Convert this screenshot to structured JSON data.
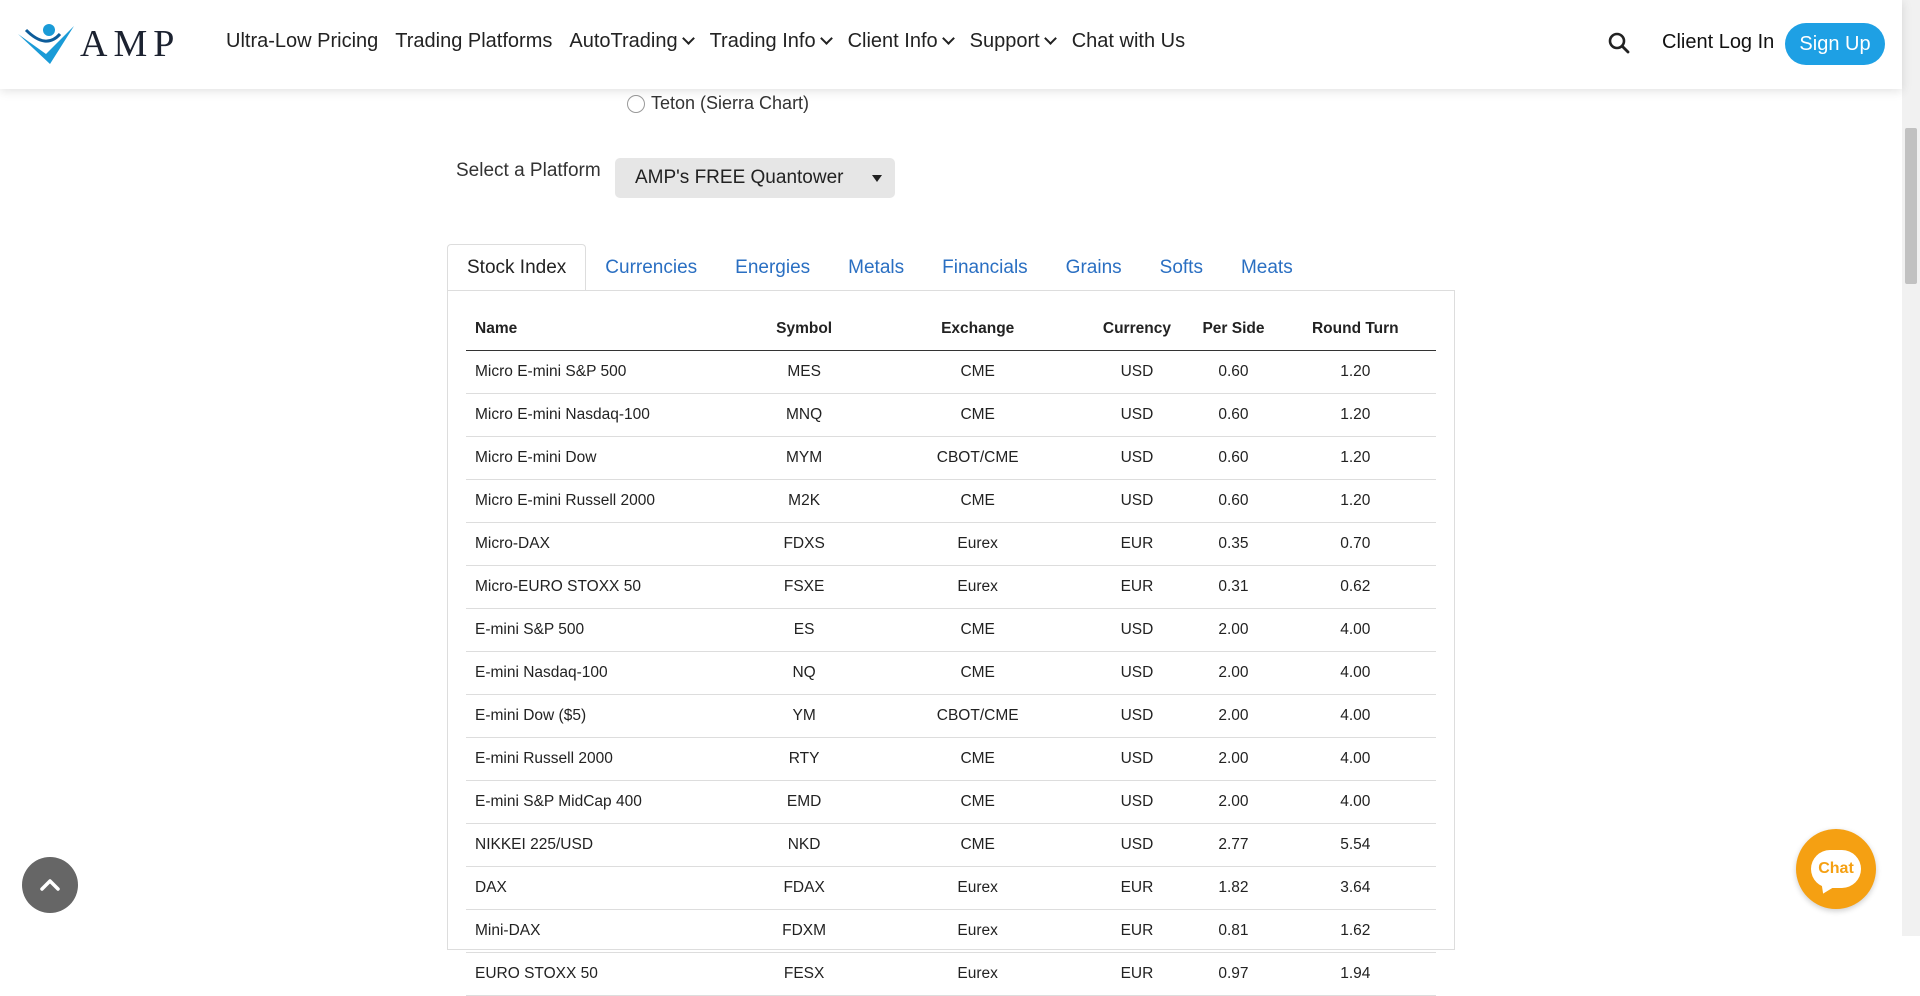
{
  "header": {
    "logo_text": "AMP",
    "nav": [
      {
        "label": "Ultra-Low Pricing",
        "dropdown": false
      },
      {
        "label": "Trading Platforms",
        "dropdown": false
      },
      {
        "label": "AutoTrading",
        "dropdown": true
      },
      {
        "label": "Trading Info",
        "dropdown": true
      },
      {
        "label": "Client Info",
        "dropdown": true
      },
      {
        "label": "Support",
        "dropdown": true
      },
      {
        "label": "Chat with Us",
        "dropdown": false
      }
    ],
    "login_label": "Client Log In",
    "signup_label": "Sign Up"
  },
  "platform": {
    "radio_label": "Teton (Sierra Chart)",
    "select_label": "Select a Platform",
    "select_value": "AMP's FREE Quantower"
  },
  "tabs": [
    "Stock Index",
    "Currencies",
    "Energies",
    "Metals",
    "Financials",
    "Grains",
    "Softs",
    "Meats"
  ],
  "table": {
    "headers": [
      "Name",
      "Symbol",
      "Exchange",
      "Currency",
      "Per Side",
      "Round Turn"
    ],
    "rows": [
      [
        "Micro E-mini S&P 500",
        "MES",
        "CME",
        "USD",
        "0.60",
        "1.20"
      ],
      [
        "Micro E-mini Nasdaq-100",
        "MNQ",
        "CME",
        "USD",
        "0.60",
        "1.20"
      ],
      [
        "Micro E-mini Dow",
        "MYM",
        "CBOT/CME",
        "USD",
        "0.60",
        "1.20"
      ],
      [
        "Micro E-mini Russell 2000",
        "M2K",
        "CME",
        "USD",
        "0.60",
        "1.20"
      ],
      [
        "Micro-DAX",
        "FDXS",
        "Eurex",
        "EUR",
        "0.35",
        "0.70"
      ],
      [
        "Micro-EURO STOXX 50",
        "FSXE",
        "Eurex",
        "EUR",
        "0.31",
        "0.62"
      ],
      [
        "E-mini S&P 500",
        "ES",
        "CME",
        "USD",
        "2.00",
        "4.00"
      ],
      [
        "E-mini Nasdaq-100",
        "NQ",
        "CME",
        "USD",
        "2.00",
        "4.00"
      ],
      [
        "E-mini Dow ($5)",
        "YM",
        "CBOT/CME",
        "USD",
        "2.00",
        "4.00"
      ],
      [
        "E-mini Russell 2000",
        "RTY",
        "CME",
        "USD",
        "2.00",
        "4.00"
      ],
      [
        "E-mini S&P MidCap 400",
        "EMD",
        "CME",
        "USD",
        "2.00",
        "4.00"
      ],
      [
        "NIKKEI 225/USD",
        "NKD",
        "CME",
        "USD",
        "2.77",
        "5.54"
      ],
      [
        "DAX",
        "FDAX",
        "Eurex",
        "EUR",
        "1.82",
        "3.64"
      ],
      [
        "Mini-DAX",
        "FDXM",
        "Eurex",
        "EUR",
        "0.81",
        "1.62"
      ],
      [
        "EURO STOXX 50",
        "FESX",
        "Eurex",
        "EUR",
        "0.97",
        "1.94"
      ]
    ]
  },
  "chat_label": "Chat",
  "colors": {
    "accent": "#1ea0e4",
    "link": "#2a6fc2",
    "chat": "#f5a012"
  }
}
